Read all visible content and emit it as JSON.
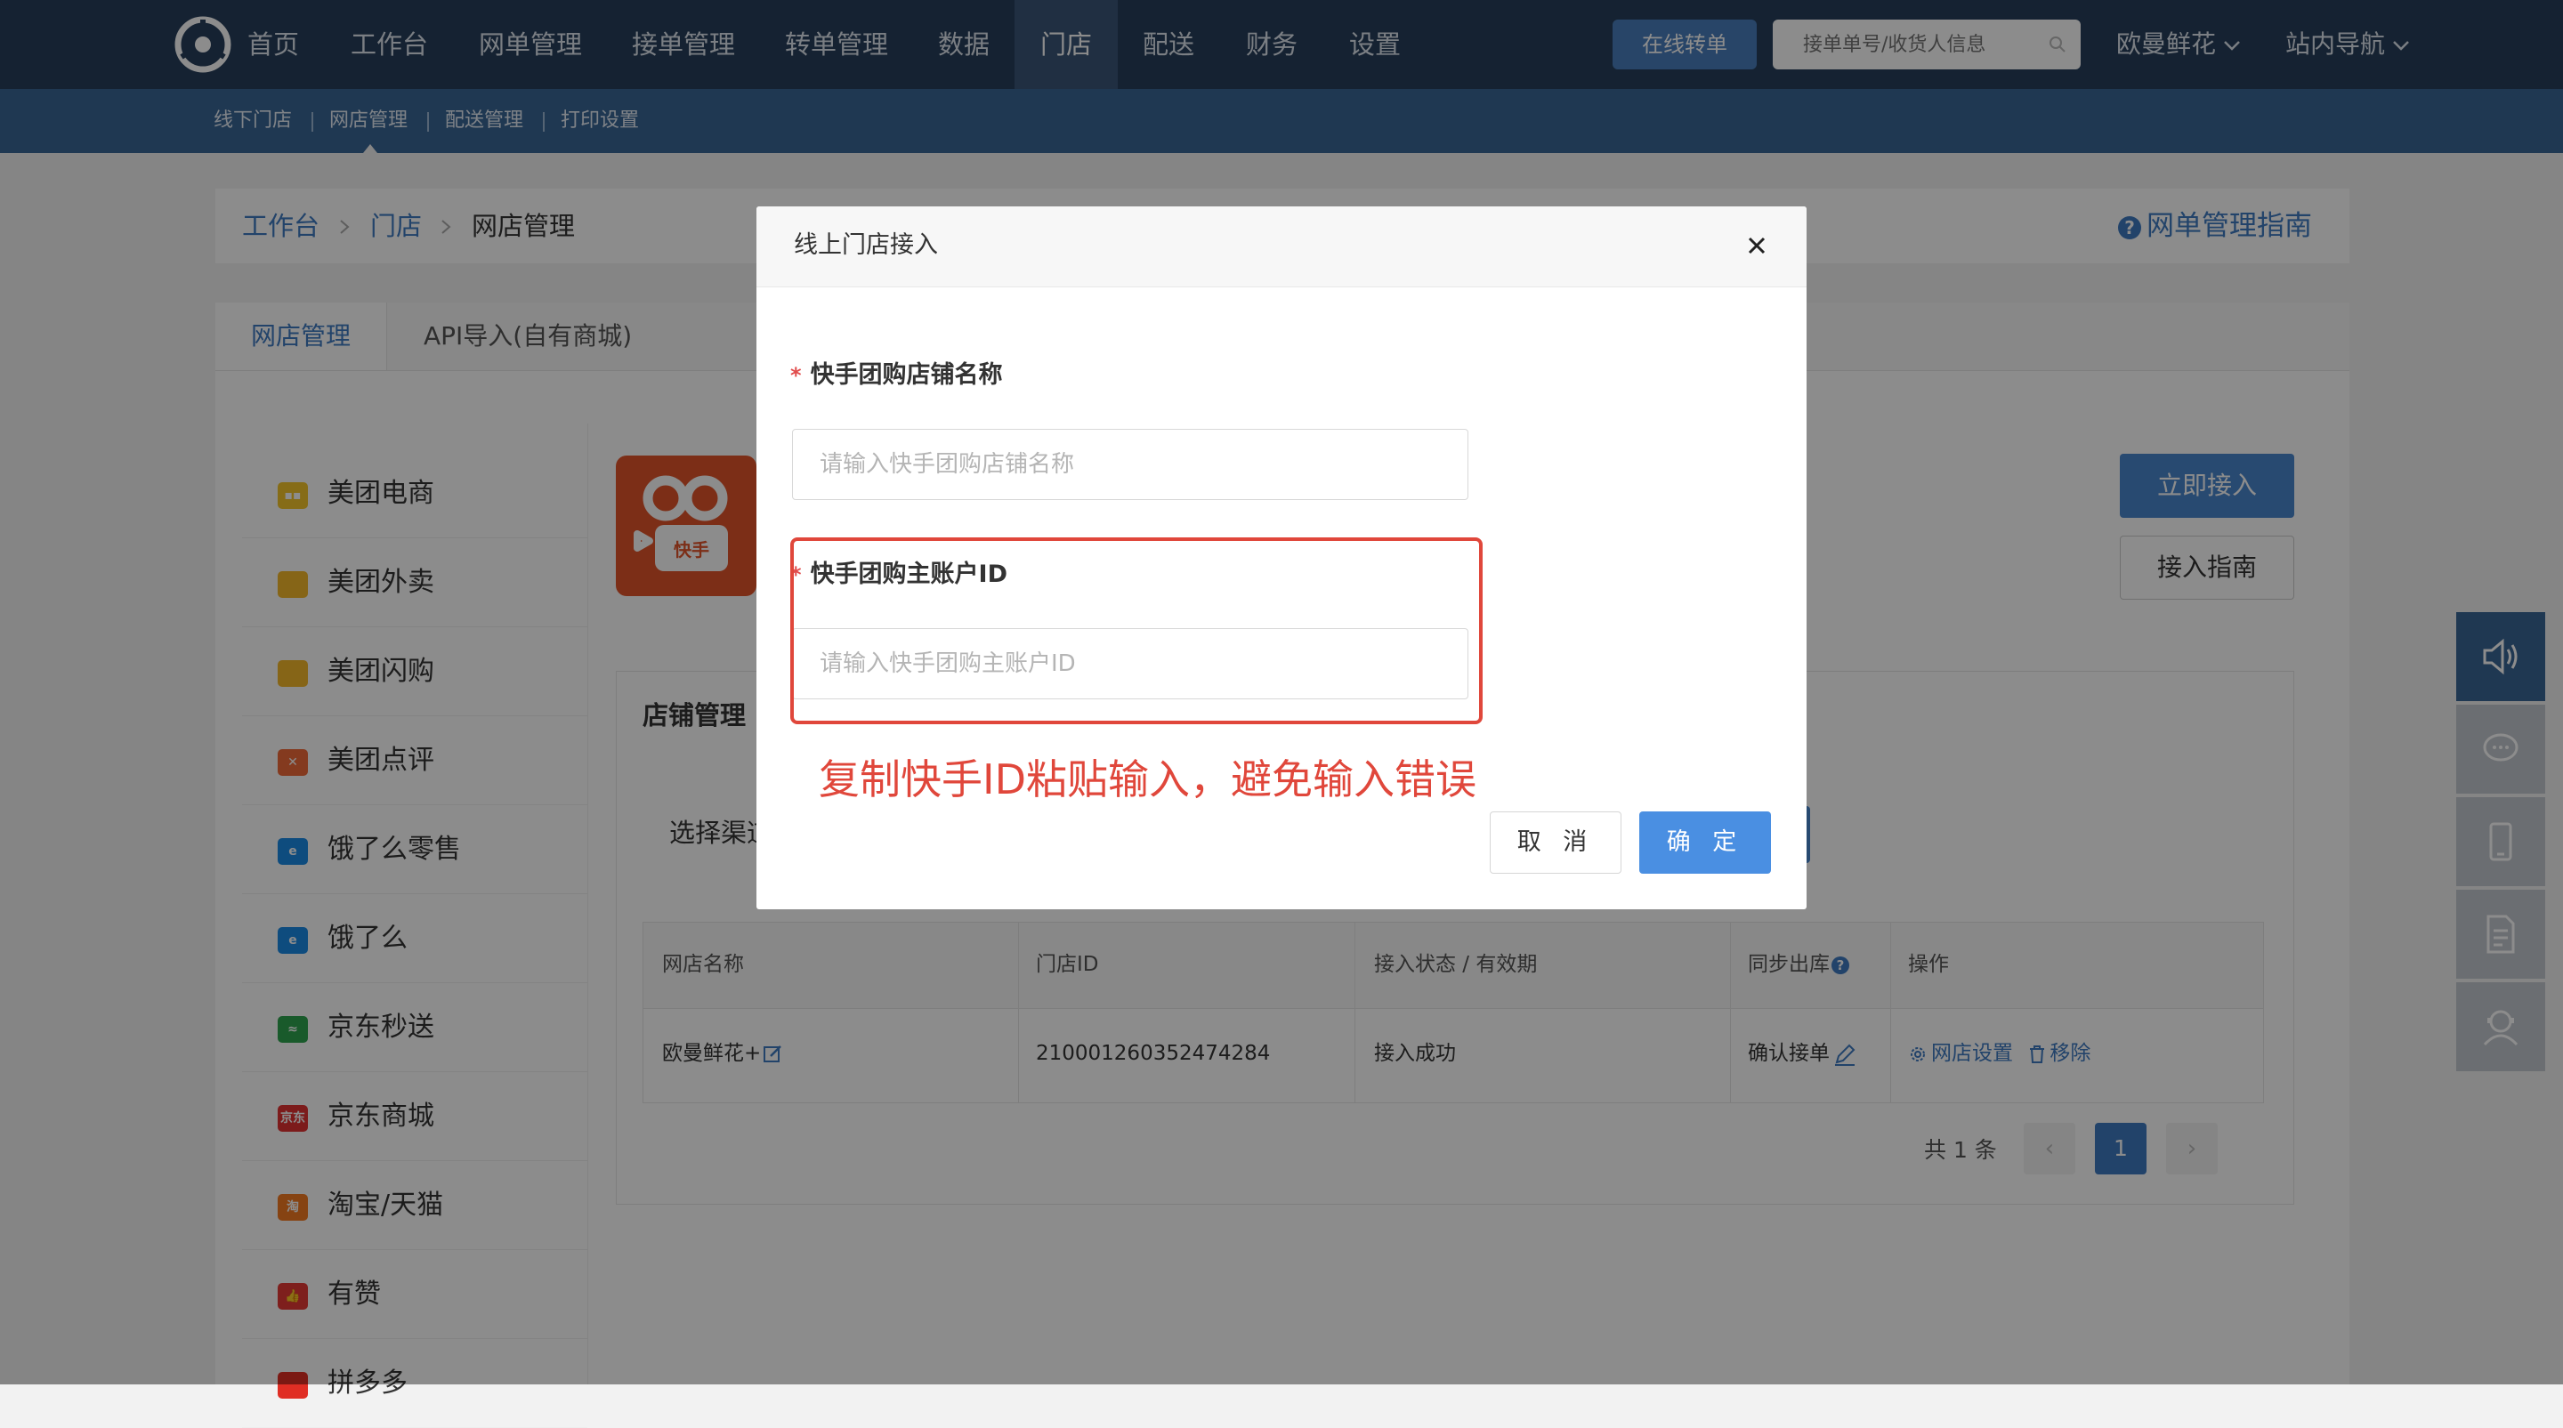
{
  "topnav": {
    "items": [
      "首页",
      "工作台",
      "网单管理",
      "接单管理",
      "转单管理",
      "数据",
      "门店",
      "配送",
      "财务",
      "设置"
    ],
    "active": "门店",
    "transfer_button": "在线转单",
    "search_placeholder": "接单单号/收货人信息",
    "account": "欧曼鲜花",
    "site_nav": "站内导航"
  },
  "subnav": {
    "items": [
      "线下门店",
      "网店管理",
      "配送管理",
      "打印设置"
    ]
  },
  "breadcrumb": {
    "items": [
      "工作台",
      "门店",
      "网店管理"
    ],
    "guide": "网单管理指南"
  },
  "tabs": [
    "网店管理",
    "API导入(自有商城)"
  ],
  "sidebar": {
    "items": [
      {
        "label": "美团电商",
        "color": "#f5c52b",
        "icon": "meituan-icon",
        "glyph": "▪▪"
      },
      {
        "label": "美团外卖",
        "color": "#f5b82b",
        "icon": "meituan-waimai-icon",
        "glyph": ""
      },
      {
        "label": "美团闪购",
        "color": "#f5b82b",
        "icon": "meituan-shangou-icon",
        "glyph": ""
      },
      {
        "label": "美团点评",
        "color": "#f06a3a",
        "icon": "dianping-icon",
        "glyph": "✕"
      },
      {
        "label": "饿了么零售",
        "color": "#1a8ae6",
        "icon": "eleme-icon",
        "glyph": "e"
      },
      {
        "label": "饿了么",
        "color": "#1a8ae6",
        "icon": "eleme-icon",
        "glyph": "e"
      },
      {
        "label": "京东秒送",
        "color": "#2ea44f",
        "icon": "jd-miaosong-icon",
        "glyph": "≈"
      },
      {
        "label": "京东商城",
        "color": "#e23232",
        "icon": "jd-mall-icon",
        "glyph": "京东"
      },
      {
        "label": "淘宝/天猫",
        "color": "#f57a22",
        "icon": "taobao-icon",
        "glyph": "淘"
      },
      {
        "label": "有赞",
        "color": "#e53935",
        "icon": "youzan-icon",
        "glyph": "👍"
      },
      {
        "label": "拼多多",
        "color": "#e02e24",
        "icon": "pdd-icon",
        "glyph": ""
      }
    ]
  },
  "platform": {
    "logo_text": "快手",
    "connect_button": "立即接入",
    "guide_button": "接入指南"
  },
  "store_manage": {
    "title": "店铺管理",
    "choose_label": "选择渠道",
    "columns": [
      "网店名称",
      "门店ID",
      "接入状态 / 有效期",
      "同步出库",
      "操作"
    ],
    "rows": [
      {
        "name": "欧曼鲜花+",
        "store_id": "210001260352474284",
        "status": "接入成功",
        "sync": "确认接单",
        "action_settings": "网店设置",
        "action_remove": "移除"
      }
    ],
    "pagination": {
      "total": "共 1 条",
      "current": "1"
    }
  },
  "modal": {
    "title": "线上门店接入",
    "field1_label": "快手团购店铺名称",
    "field1_placeholder": "请输入快手团购店铺名称",
    "field2_label": "快手团购主账户ID",
    "field2_placeholder": "请输入快手团购主账户ID",
    "annotation": "复制快手ID粘贴输入，避免输入错误",
    "cancel": "取 消",
    "ok": "确 定"
  },
  "colors": {
    "nav_bg": "#273f5b",
    "subnav_bg": "#3a6696",
    "accent": "#3e7ac2",
    "annotation_red": "#e0473b"
  }
}
